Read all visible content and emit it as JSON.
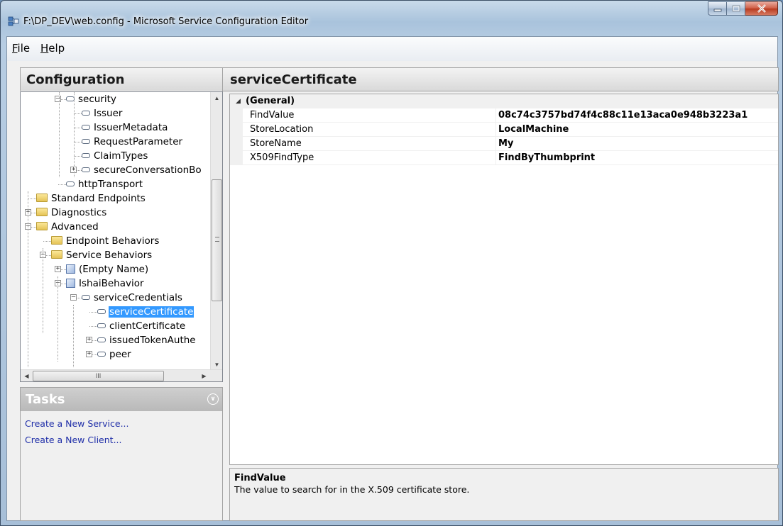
{
  "window": {
    "title": "F:\\DP_DEV\\web.config - Microsoft Service Configuration Editor",
    "min_glyph": "–",
    "max_glyph": "☐",
    "close_glyph": "X"
  },
  "menu": {
    "file": {
      "accel": "F",
      "rest": "ile"
    },
    "help": {
      "accel": "H",
      "rest": "elp"
    }
  },
  "config_panel": {
    "title": "Configuration",
    "tree": [
      {
        "label": "security",
        "icon": "element-icon",
        "expander": "minus"
      },
      {
        "label": "Issuer",
        "icon": "element-icon",
        "expander": ""
      },
      {
        "label": "IssuerMetadata",
        "icon": "element-icon",
        "expander": ""
      },
      {
        "label": "RequestParameter",
        "icon": "element-icon",
        "expander": ""
      },
      {
        "label": "ClaimTypes",
        "icon": "element-icon",
        "expander": ""
      },
      {
        "label": "secureConversationBo",
        "icon": "element-icon",
        "expander": "plus"
      },
      {
        "label": "httpTransport",
        "icon": "element-icon",
        "expander": ""
      },
      {
        "label": "Standard Endpoints",
        "icon": "folder-icon",
        "expander": ""
      },
      {
        "label": "Diagnostics",
        "icon": "folder-icon",
        "expander": "plus"
      },
      {
        "label": "Advanced",
        "icon": "folder-icon",
        "expander": "minus"
      },
      {
        "label": "Endpoint Behaviors",
        "icon": "folder-icon",
        "expander": ""
      },
      {
        "label": "Service Behaviors",
        "icon": "folder-icon",
        "expander": "minus"
      },
      {
        "label": "(Empty Name)",
        "icon": "behavior-icon",
        "expander": "plus"
      },
      {
        "label": "IshaiBehavior",
        "icon": "behavior-icon",
        "expander": "minus"
      },
      {
        "label": "serviceCredentials",
        "icon": "element-icon",
        "expander": "minus"
      },
      {
        "label": "serviceCertificate",
        "icon": "element-icon",
        "expander": "",
        "selected": true
      },
      {
        "label": "clientCertificate",
        "icon": "element-icon",
        "expander": ""
      },
      {
        "label": "issuedTokenAuthe",
        "icon": "element-icon",
        "expander": "plus"
      },
      {
        "label": "peer",
        "icon": "element-icon",
        "expander": "plus"
      }
    ],
    "hscroll_grip": "III"
  },
  "tasks_panel": {
    "title": "Tasks",
    "links": [
      "Create a New Service...",
      "Create a New Client..."
    ]
  },
  "detail_panel": {
    "title": "serviceCertificate",
    "category": "(General)",
    "properties": [
      {
        "name": "FindValue",
        "value": "08c74c3757bd74f4c88c11e13aca0e948b3223a1"
      },
      {
        "name": "StoreLocation",
        "value": "LocalMachine"
      },
      {
        "name": "StoreName",
        "value": "My"
      },
      {
        "name": "X509FindType",
        "value": "FindByThumbprint"
      }
    ],
    "help": {
      "title": "FindValue",
      "description": "The value to search for in the X.509 certificate store."
    }
  },
  "colors": {
    "selection": "#3399ff",
    "link": "#1f2ea8",
    "tasks_header": "#c4c4c4"
  }
}
